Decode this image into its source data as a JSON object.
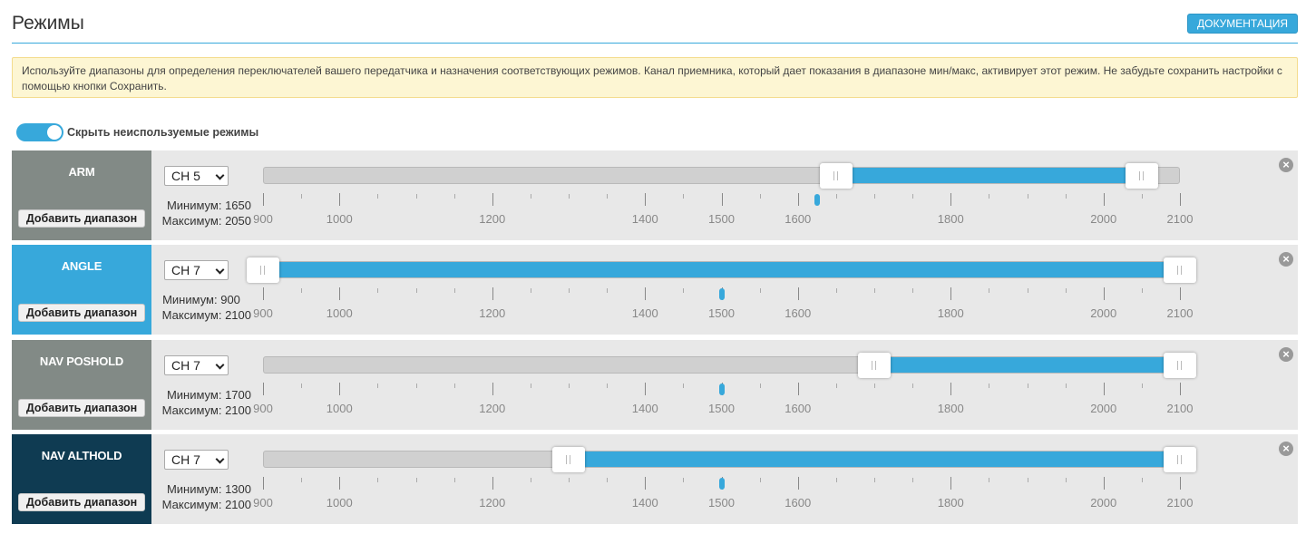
{
  "header": {
    "title": "Режимы",
    "doc_button": "ДОКУМЕНТАЦИЯ"
  },
  "note": "Используйте диапазоны для определения переключателей вашего передатчика и назначения соответствующих режимов. Канал приемника, который дает показания в диапазоне мин/макс, активирует этот режим. Не забудьте сохранить настройки с помощью кнопки Сохранить.",
  "toggle": {
    "label": "Скрыть неиспользуемые режимы",
    "on": true
  },
  "scale": {
    "min": 900,
    "max": 2100,
    "labels": [
      900,
      1000,
      1200,
      1400,
      1500,
      1600,
      1800,
      2000,
      2100
    ]
  },
  "add_range_label": "Добавить диапазон",
  "colors": {
    "accent": "#37a8db",
    "gray_mode": "#828a86",
    "dark_mode": "#0f3b52",
    "active_mode": "#37a8db"
  },
  "modes": [
    {
      "name": "ARM",
      "channel": "CH 5",
      "min_text": "Минимум: 1650",
      "max_text": "Максимум: 2050",
      "range_min": 1650,
      "range_max": 2050,
      "value": 1625,
      "color": "#828a86"
    },
    {
      "name": "ANGLE",
      "channel": "CH 7",
      "min_text": "Минимум: 900",
      "max_text": "Максимум: 2100",
      "range_min": 900,
      "range_max": 2100,
      "value": 1500,
      "color": "#37a8db"
    },
    {
      "name": "NAV POSHOLD",
      "channel": "CH 7",
      "min_text": "Минимум: 1700",
      "max_text": "Максимум: 2100",
      "range_min": 1700,
      "range_max": 2100,
      "value": 1500,
      "color": "#828a86"
    },
    {
      "name": "NAV ALTHOLD",
      "channel": "CH 7",
      "min_text": "Минимум: 1300",
      "max_text": "Максимум: 2100",
      "range_min": 1300,
      "range_max": 2100,
      "value": 1500,
      "color": "#0f3b52"
    }
  ]
}
